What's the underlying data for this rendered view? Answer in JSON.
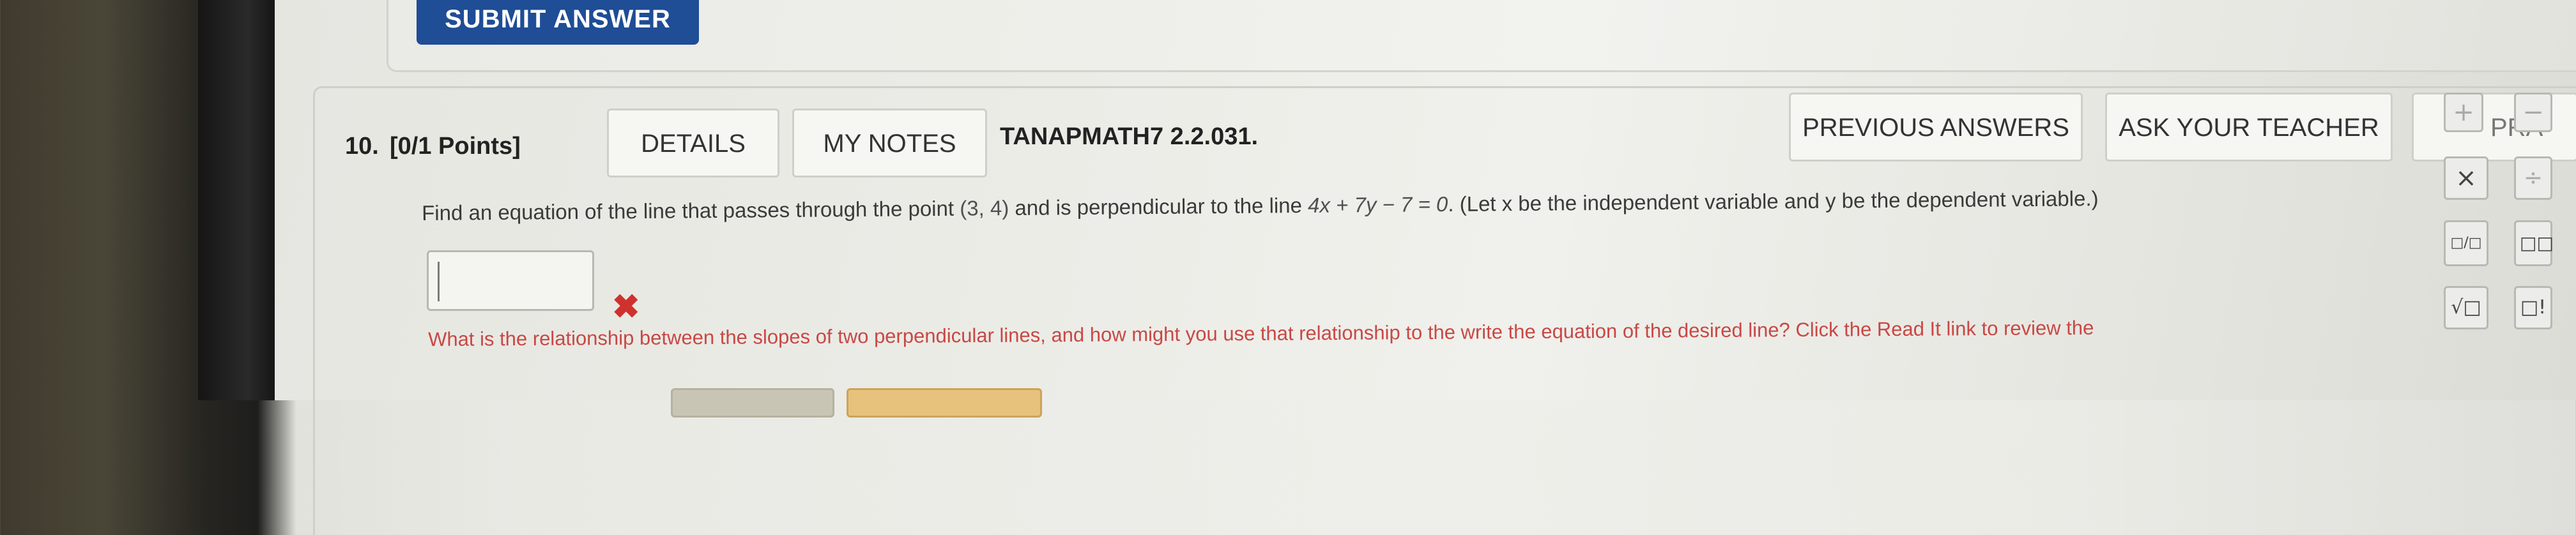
{
  "toolbar": {
    "submit_label": "SUBMIT ANSWER"
  },
  "question": {
    "number": "10.",
    "points": "[0/1 Points]",
    "details_label": "DETAILS",
    "my_notes_label": "MY NOTES",
    "code": "TANAPMATH7 2.2.031.",
    "previous_answers_label": "PREVIOUS ANSWERS",
    "ask_teacher_label": "ASK YOUR TEACHER",
    "practice_label": "PRA",
    "statement_lead": "Find an equation of the line that passes through the point ",
    "point": "(3, 4)",
    "statement_mid": " and is perpendicular to the line ",
    "line_equation": "4x + 7y − 7 = 0",
    "statement_tail": ". (Let x be the independent variable and y be the dependent variable.)",
    "answer_value": "",
    "hint": "What is the relationship between the slopes of two perpendicular lines, and how might you use that relationship to the write the equation of the desired line? Click the Read It link to review the"
  },
  "palette": {
    "plus": "+",
    "times": "×",
    "fraction": "□/□",
    "power": "□□",
    "sqrt": "√□",
    "factorial": "□!",
    "minus": "−",
    "divide": "÷"
  },
  "colors": {
    "submit_bg": "#1f4d96",
    "wrong": "#d0312d",
    "hint_text": "#c84844"
  }
}
